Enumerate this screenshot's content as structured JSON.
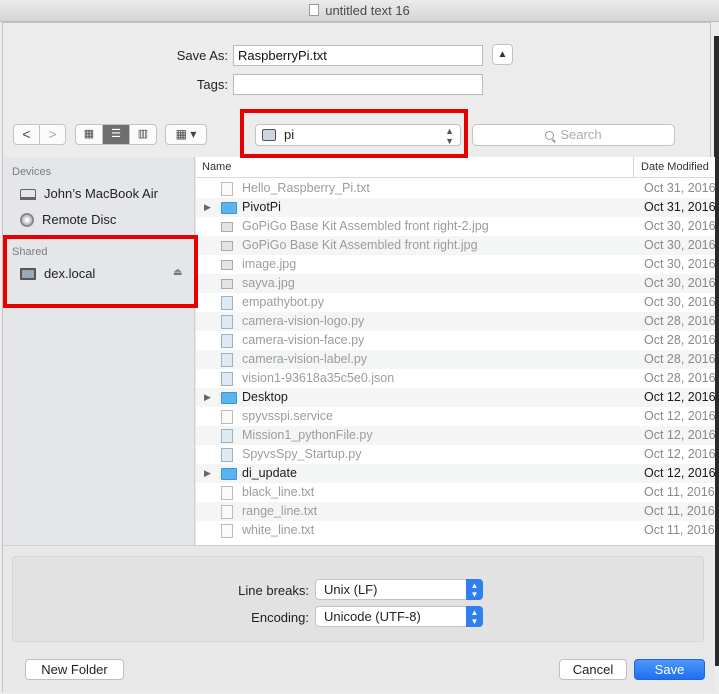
{
  "window": {
    "title": "untitled text 16"
  },
  "save": {
    "save_as_label": "Save As:",
    "save_as_value": "RaspberryPi.txt",
    "tags_label": "Tags:",
    "tags_value": ""
  },
  "toolbar": {
    "back_glyph": "<",
    "forward_glyph": ">",
    "location": "pi",
    "search_placeholder": "Search"
  },
  "sidebar": {
    "devices_header": "Devices",
    "devices": [
      {
        "label": "John’s MacBook Air",
        "icon": "laptop-icon"
      },
      {
        "label": "Remote Disc",
        "icon": "disc-icon"
      }
    ],
    "shared_header": "Shared",
    "shared": [
      {
        "label": "dex.local",
        "icon": "monitor-icon"
      }
    ]
  },
  "list": {
    "col_name": "Name",
    "col_date": "Date Modified",
    "files": [
      {
        "name": "Hello_Raspberry_Pi.txt",
        "date": "Oct 31, 2016",
        "kind": "txt"
      },
      {
        "name": "PivotPi",
        "date": "Oct 31, 2016",
        "kind": "folder"
      },
      {
        "name": "GoPiGo Base Kit Assembled front right-2.jpg",
        "date": "Oct 30, 2016",
        "kind": "img"
      },
      {
        "name": "GoPiGo Base Kit Assembled front right.jpg",
        "date": "Oct 30, 2016",
        "kind": "img"
      },
      {
        "name": "image.jpg",
        "date": "Oct 30, 2016",
        "kind": "img"
      },
      {
        "name": "sayva.jpg",
        "date": "Oct 30, 2016",
        "kind": "img"
      },
      {
        "name": "empathybot.py",
        "date": "Oct 30, 2016",
        "kind": "py"
      },
      {
        "name": "camera-vision-logo.py",
        "date": "Oct 28, 2016",
        "kind": "py"
      },
      {
        "name": "camera-vision-face.py",
        "date": "Oct 28, 2016",
        "kind": "py"
      },
      {
        "name": "camera-vision-label.py",
        "date": "Oct 28, 2016",
        "kind": "py"
      },
      {
        "name": "vision1-93618a35c5e0.json",
        "date": "Oct 28, 2016",
        "kind": "json"
      },
      {
        "name": "Desktop",
        "date": "Oct 12, 2016",
        "kind": "folder"
      },
      {
        "name": "spyvsspi.service",
        "date": "Oct 12, 2016",
        "kind": "txt"
      },
      {
        "name": "Mission1_pythonFile.py",
        "date": "Oct 12, 2016",
        "kind": "py"
      },
      {
        "name": "SpyvsSpy_Startup.py",
        "date": "Oct 12, 2016",
        "kind": "py"
      },
      {
        "name": "di_update",
        "date": "Oct 12, 2016",
        "kind": "folder"
      },
      {
        "name": "black_line.txt",
        "date": "Oct 11, 2016",
        "kind": "txt"
      },
      {
        "name": "range_line.txt",
        "date": "Oct 11, 2016",
        "kind": "txt"
      },
      {
        "name": "white_line.txt",
        "date": "Oct 11, 2016",
        "kind": "txt"
      }
    ]
  },
  "options": {
    "line_breaks_label": "Line breaks:",
    "line_breaks_value": "Unix (LF)",
    "encoding_label": "Encoding:",
    "encoding_value": "Unicode (UTF-8)"
  },
  "buttons": {
    "new_folder": "New Folder",
    "cancel": "Cancel",
    "save": "Save"
  },
  "colors": {
    "highlight_box": "#e60000",
    "accent": "#1f6ff0",
    "folder": "#5ab4ef"
  }
}
